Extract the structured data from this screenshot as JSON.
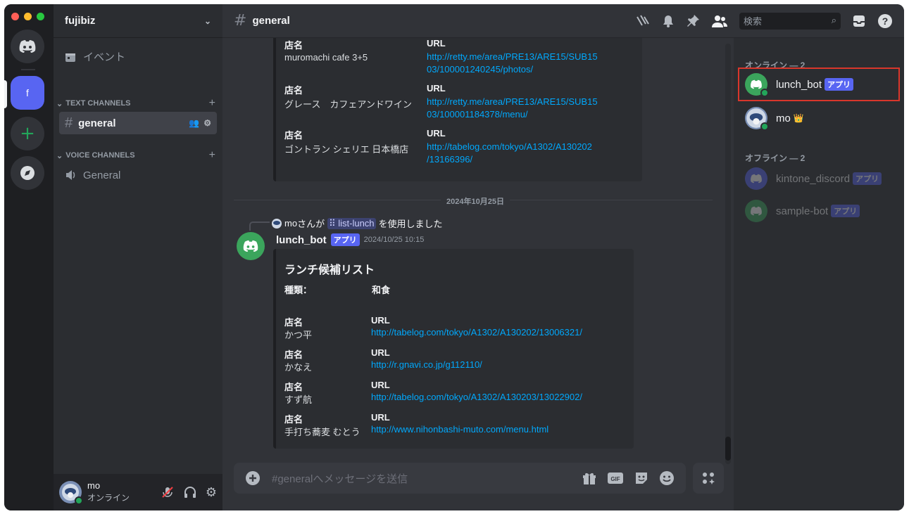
{
  "colors": {
    "accent": "#5865f2",
    "online": "#23a55a",
    "link": "#00a8fc",
    "highlight": "#d9362b"
  },
  "server": {
    "name": "fujibiz",
    "initial": "f"
  },
  "sidebar": {
    "events_label": "イベント",
    "text_category": "TEXT CHANNELS",
    "voice_category": "VOICE CHANNELS",
    "text_channels": [
      {
        "label": "general"
      }
    ],
    "voice_channels": [
      {
        "label": "General"
      }
    ]
  },
  "user": {
    "name": "mo",
    "status": "オンライン"
  },
  "header": {
    "channel": "general",
    "search_placeholder": "検索"
  },
  "earlier_embed": {
    "rows": [
      {
        "name_label": "店名",
        "name": "muromachi cafe 3+5",
        "url_label": "URL",
        "url_line1": "http://retty.me/area/PRE13/ARE15/SUB15",
        "url_line2": "03/100001240245/photos/"
      },
      {
        "name_label": "店名",
        "name": "グレース　カフェアンドワイン",
        "url_label": "URL",
        "url_line1": "http://retty.me/area/PRE13/ARE15/SUB15",
        "url_line2": "03/100001184378/menu/"
      },
      {
        "name_label": "店名",
        "name": "ゴントラン シェリエ 日本橋店",
        "url_label": "URL",
        "url_line1": "http://tabelog.com/tokyo/A1302/A130202",
        "url_line2": "/13166396/"
      }
    ]
  },
  "date_divider": "2024年10月25日",
  "reply": {
    "user": "mo",
    "text_before": "さんが",
    "command": "list-lunch",
    "text_after": "を使用しました"
  },
  "message": {
    "author": "lunch_bot",
    "badge": "アプリ",
    "timestamp": "2024/10/25 10:15",
    "embed_title": "ランチ候補リスト",
    "kind_label": "種類：",
    "kind_value": "和食",
    "rows": [
      {
        "name_label": "店名",
        "name": "かつ平",
        "url_label": "URL",
        "url": "http://tabelog.com/tokyo/A1302/A130202/13006321/"
      },
      {
        "name_label": "店名",
        "name": "かなえ",
        "url_label": "URL",
        "url": "http://r.gnavi.co.jp/g112110/"
      },
      {
        "name_label": "店名",
        "name": "すず航",
        "url_label": "URL",
        "url": "http://tabelog.com/tokyo/A1302/A130203/13022902/"
      },
      {
        "name_label": "店名",
        "name": "手打ち蕎麦 むとう",
        "url_label": "URL",
        "url": "http://www.nihonbashi-muto.com/menu.html"
      }
    ]
  },
  "composer": {
    "placeholder": "#generalへメッセージを送信"
  },
  "members": {
    "online_header": "オンライン — 2",
    "offline_header": "オフライン — 2",
    "online": [
      {
        "name": "lunch_bot",
        "badge": "アプリ"
      },
      {
        "name": "mo",
        "badge": "👑"
      }
    ],
    "offline": [
      {
        "name": "kintone_discord",
        "badge": "アプリ"
      },
      {
        "name": "sample-bot",
        "badge": "アプリ"
      }
    ]
  },
  "icons": [
    "discord-home-icon",
    "add-server-icon",
    "discover-icon",
    "calendar-icon",
    "hash-icon",
    "speaker-icon",
    "threads-icon",
    "bell-icon",
    "pin-icon",
    "members-icon",
    "search-icon",
    "inbox-icon",
    "help-icon",
    "mute-icon",
    "headphones-icon",
    "settings-icon",
    "plus-circle-icon",
    "gift-icon",
    "gif-icon",
    "sticker-icon",
    "emoji-icon",
    "apps-icon"
  ]
}
